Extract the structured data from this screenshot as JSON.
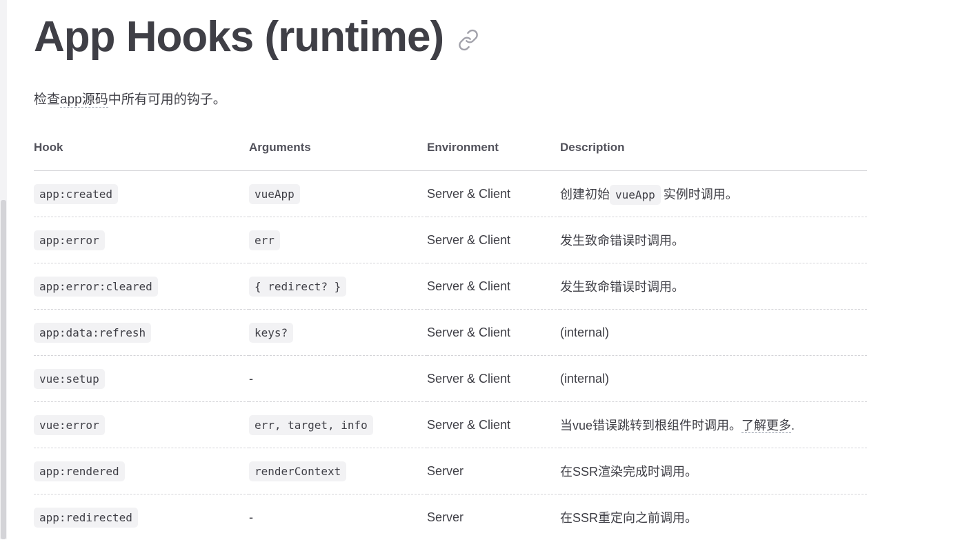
{
  "page": {
    "title": "App Hooks (runtime)",
    "anchor_icon": "link-icon",
    "intro_before": "检查",
    "intro_abbr": "app源码",
    "intro_after": "中所有可用的钩子。"
  },
  "table": {
    "headers": [
      "Hook",
      "Arguments",
      "Environment",
      "Description"
    ],
    "rows": [
      {
        "hook": "app:created",
        "args": "vueApp",
        "env": "Server & Client",
        "desc_before": "创建初始",
        "desc_code": "vueApp",
        "desc_after": "实例时调用。"
      },
      {
        "hook": "app:error",
        "args": "err",
        "env": "Server & Client",
        "desc_before": "发生致命错误时调用。"
      },
      {
        "hook": "app:error:cleared",
        "args": "{ redirect? }",
        "env": "Server & Client",
        "desc_before": "发生致命错误时调用。"
      },
      {
        "hook": "app:data:refresh",
        "args": "keys?",
        "env": "Server & Client",
        "desc_before": "(internal)"
      },
      {
        "hook": "vue:setup",
        "args": "-",
        "env": "Server & Client",
        "desc_before": "(internal)"
      },
      {
        "hook": "vue:error",
        "args": "err, target, info",
        "env": "Server & Client",
        "desc_before": "当vue错误跳转到根组件时调用。",
        "desc_link": "了解更多",
        "desc_after": "."
      },
      {
        "hook": "app:rendered",
        "args": "renderContext",
        "env": "Server",
        "desc_before": "在SSR渲染完成时调用。"
      },
      {
        "hook": "app:redirected",
        "args": "-",
        "env": "Server",
        "desc_before": "在SSR重定向之前调用。"
      }
    ]
  }
}
